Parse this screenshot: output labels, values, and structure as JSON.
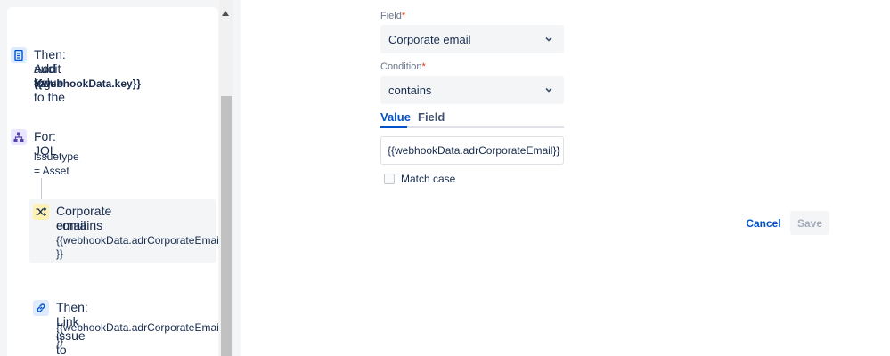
{
  "rule_steps": [
    {
      "type": "action",
      "icon": "audit-log-icon",
      "title_line1": "Then: Add value to the",
      "title_line2": "audit log.",
      "detail": "{{webhookData.key}}"
    },
    {
      "type": "branch",
      "icon": "branch-icon",
      "title": "For: JQL",
      "detail": "issuetype = Asset"
    },
    {
      "type": "condition",
      "icon": "condition-icon",
      "title_line1": "Corporate email",
      "title_line2": "contains",
      "detail_line1": "{{webhookData.adrCorporateEmail",
      "detail_line2": "}}"
    },
    {
      "type": "action",
      "icon": "link-icon",
      "title": "Then: Link issue to",
      "detail_line1": "{{webhookData.adrCorporateEmail",
      "detail_line2": "}}"
    }
  ],
  "form": {
    "field_label": "Field",
    "field_value": "Corporate email",
    "condition_label": "Condition",
    "condition_value": "contains",
    "required_marker": "*",
    "tabs": [
      {
        "label": "Value",
        "active": true
      },
      {
        "label": "Field",
        "active": false
      }
    ],
    "value_input": "{{webhookData.adrCorporateEmail}}",
    "match_case_label": "Match case",
    "match_case_checked": false
  },
  "buttons": {
    "cancel": "Cancel",
    "save": "Save"
  },
  "colors": {
    "accent": "#0052cc",
    "text": "#172b4d",
    "required": "#de350b",
    "muted": "#6b778c"
  }
}
